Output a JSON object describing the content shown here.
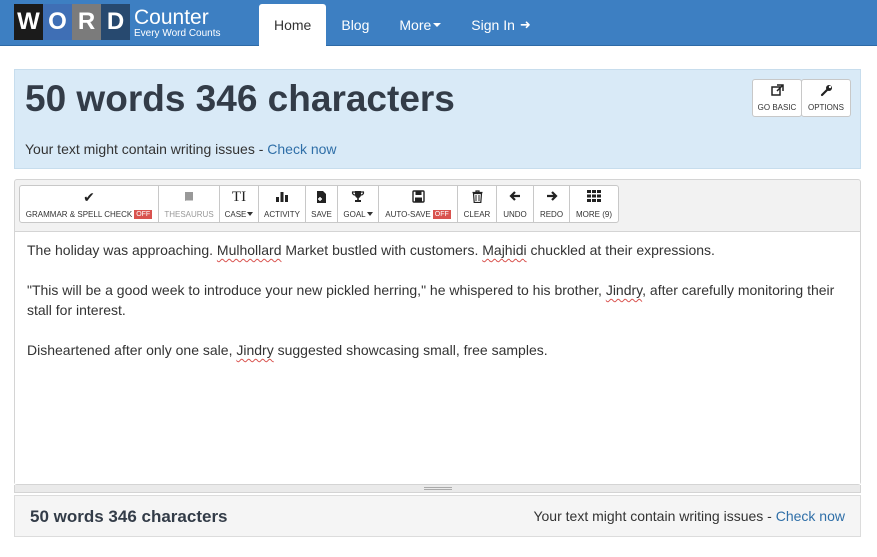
{
  "logo": {
    "letters": [
      "W",
      "O",
      "R",
      "D"
    ],
    "title": "Counter",
    "subtitle": "Every Word Counts"
  },
  "nav": [
    {
      "label": "Home",
      "active": true
    },
    {
      "label": "Blog"
    },
    {
      "label": "More"
    },
    {
      "label": "Sign In"
    }
  ],
  "header": {
    "count": "50 words 346 characters",
    "issues_text": "Your text might contain writing issues - ",
    "issues_link": "Check now",
    "buttons": [
      {
        "icon": "external-link-icon",
        "label": "GO BASIC"
      },
      {
        "icon": "wrench-icon",
        "label": "OPTIONS"
      }
    ]
  },
  "toolbar": [
    {
      "icon": "check-icon",
      "label": "GRAMMAR & SPELL CHECK",
      "badge": "OFF"
    },
    {
      "icon": "book-icon",
      "label": "THESAURUS"
    },
    {
      "icon": "text-case-icon",
      "label": "CASE"
    },
    {
      "icon": "bar-chart-icon",
      "label": "ACTIVITY"
    },
    {
      "icon": "save-file-icon",
      "label": "SAVE"
    },
    {
      "icon": "trophy-icon",
      "label": "GOAL"
    },
    {
      "icon": "floppy-disk-icon",
      "label": "AUTO-SAVE",
      "badge": "OFF"
    },
    {
      "icon": "trash-icon",
      "label": "CLEAR"
    },
    {
      "icon": "arrow-left-icon",
      "label": "UNDO"
    },
    {
      "icon": "arrow-right-icon",
      "label": "REDO"
    },
    {
      "icon": "grid-icon",
      "label": "MORE (9)"
    }
  ],
  "editor": {
    "p1": {
      "a": "The holiday was approaching. ",
      "b": "Mulhollard",
      "c": " Market bustled with customers. ",
      "d": "Majhidi",
      "e": " chuckled at their expressions."
    },
    "p2": {
      "a": "\"This will be a good week to introduce your new pickled herring,\" he whispered to his brother, ",
      "b": "Jindry",
      "c": ", after carefully monitoring their stall for interest."
    },
    "p3": {
      "a": "Disheartened after only one sale, ",
      "b": "Jindry",
      "c": " suggested showcasing small, free samples."
    }
  },
  "footer": {
    "count": "50 words 346 characters",
    "issues_text": "Your text might contain writing issues - ",
    "issues_link": "Check now"
  }
}
